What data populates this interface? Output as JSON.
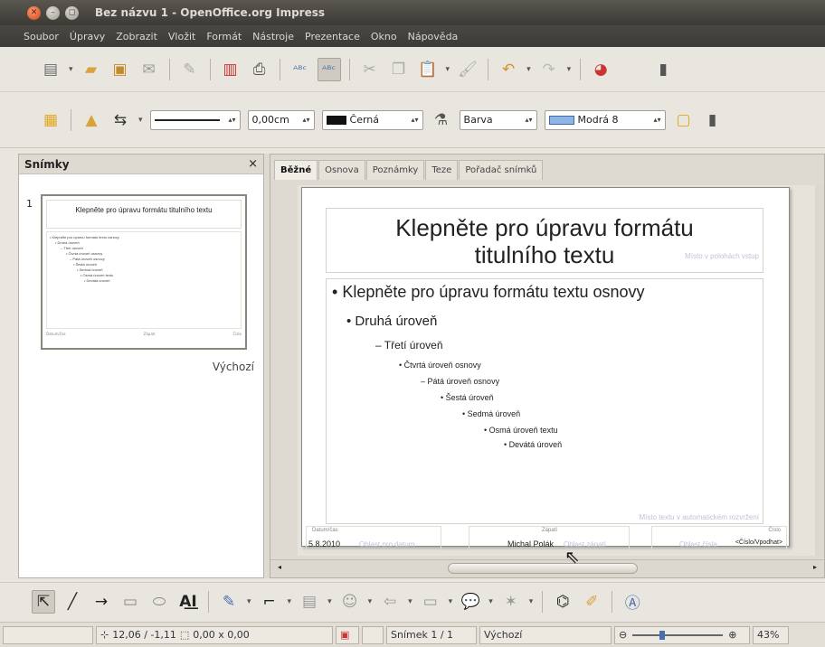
{
  "window": {
    "title": "Bez názvu 1 - OpenOffice.org Impress"
  },
  "menu": [
    "Soubor",
    "Úpravy",
    "Zobrazit",
    "Vložit",
    "Formát",
    "Nástroje",
    "Prezentace",
    "Okno",
    "Nápověda"
  ],
  "toolbar2": {
    "line_width": "0,00cm",
    "line_color": "Černá",
    "area_style": "Barva",
    "area_color": "Modrá 8"
  },
  "slides_panel": {
    "title": "Snímky",
    "close_glyph": "×",
    "slide_number": "1",
    "layout_name": "Výchozí"
  },
  "tabs": [
    "Běžné",
    "Osnova",
    "Poznámky",
    "Teze",
    "Pořadač snímků"
  ],
  "slide": {
    "title_line1": "Klepněte pro úpravu formátu",
    "title_line2": "titulního textu",
    "title_ghost": "Místo v polohách vstup",
    "levels": [
      "Klepněte pro úpravu formátu textu osnovy",
      "Druhá úroveň",
      "Třetí úroveň",
      "Čtvrtá úroveň osnovy",
      "Pátá úroveň osnovy",
      "Šestá úroveň",
      "Sedmá úroveň",
      "Osmá úroveň textu",
      "Devátá úroveň"
    ],
    "body_ghost": "Místo textu v automatickém rozvržení",
    "footer": {
      "date_label": "Datum/čas",
      "date": "5.8.2010",
      "date_ghost": "Oblast pro datum",
      "center_label": "Zápatí",
      "author": "Michal Polák",
      "center_ghost": "Oblast zápatí",
      "num_label": "Číslo",
      "number": "<Číslo/Vpodhat>",
      "num_ghost": "Oblast čísla"
    }
  },
  "thumbnail": {
    "title": "Klepněte pro úpravu formátu titulního textu",
    "lines": [
      "• Klepněte pro úpravu formátu textu osnovy",
      "• Druhá úroveň",
      "– Třetí úroveň",
      "• Čtvrtá úroveň osnovy",
      "– Pátá úroveň osnovy",
      "• Šestá úroveň",
      "• Sedmá úroveň",
      "• Osmá úroveň textu",
      "• Devátá úroveň"
    ]
  },
  "statusbar": {
    "position": "12,06 / -1,11",
    "size": "0,00 x 0,00",
    "slide_info": "Snímek 1 / 1",
    "layout": "Výchozí",
    "zoom": "43%"
  },
  "colors": {
    "title_bg": "#3c3a36",
    "close_button": "#d2431a",
    "area_blue": "#8fb4e6"
  }
}
